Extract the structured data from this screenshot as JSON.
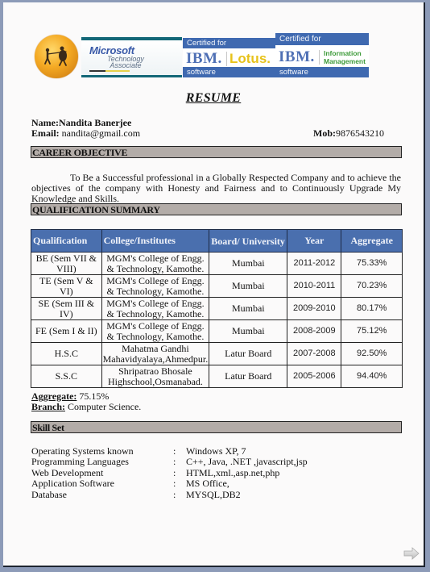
{
  "banner": {
    "logo_icon": "tug-of-war-logo-icon",
    "microsoft": {
      "brand": "Microsoft",
      "line1": "Technology",
      "line2": "Associate"
    },
    "ibm_lotus": {
      "certified_label": "Certified for",
      "ibm": "IBM.",
      "product": "Lotus.",
      "software_label": "software"
    },
    "ibm_info": {
      "certified_label": "Certified for",
      "ibm": "IBM.",
      "product_line1": "Information",
      "product_line2": "Management",
      "software_label": "software"
    }
  },
  "title": "RESUME",
  "contact": {
    "name_label": "Name:",
    "name": "Nandita Banerjee",
    "email_label": "Email:",
    "email": " nandita@gmail.com",
    "mob_label": "Mob:",
    "mob": "9876543210"
  },
  "career_objective": {
    "heading": "CAREER OBJECTIVE",
    "text": "To Be a Successful professional in a Globally Respected Company and to achieve the objectives of the company with Honesty and Fairness and to Continuously Upgrade My Knowledge and Skills."
  },
  "qualification": {
    "heading": "QUALIFICATION SUMMARY",
    "columns": [
      "Qualification",
      "College/Institutes",
      "Board/ University",
      "Year",
      "Aggregate"
    ],
    "rows": [
      {
        "qualification": "BE (Sem VII & VIII)",
        "college": "MGM's College of Engg. & Technology, Kamothe.",
        "board": "Mumbai",
        "year": "2011-2012",
        "aggregate": "75.33%"
      },
      {
        "qualification": "TE (Sem V & VI)",
        "college": "MGM's College of Engg. & Technology, Kamothe.",
        "board": "Mumbai",
        "year": "2010-2011",
        "aggregate": "70.23%"
      },
      {
        "qualification": "SE (Sem III & IV)",
        "college": "MGM's College of Engg. & Technology, Kamothe.",
        "board": "Mumbai",
        "year": "2009-2010",
        "aggregate": "80.17%"
      },
      {
        "qualification": "FE (Sem I & II)",
        "college": "MGM's College of Engg. & Technology, Kamothe.",
        "board": "Mumbai",
        "year": "2008-2009",
        "aggregate": "75.12%"
      },
      {
        "qualification": "H.S.C",
        "college": "Mahatma Gandhi Mahavidyalaya,Ahmedpur.",
        "board": "Latur Board",
        "year": "2007-2008",
        "aggregate": "92.50%"
      },
      {
        "qualification": "S.S.C",
        "college": "Shripatrao Bhosale Highschool,Osmanabad.",
        "board": "Latur Board",
        "year": "2005-2006",
        "aggregate": "94.40%"
      }
    ],
    "aggregate_label": "Aggregate:",
    "aggregate_value": " 75.15%",
    "branch_label": "Branch:",
    "branch_value": " Computer Science."
  },
  "skills": {
    "heading": "Skill Set",
    "items": [
      {
        "label": "Operating Systems known",
        "value": "Windows XP, 7"
      },
      {
        "label": "Programming Languages",
        "value": "C++, Java, .NET ,javascript,jsp"
      },
      {
        "label": "Web Development",
        "value": "HTML,xml.,asp.net,php"
      },
      {
        "label": "Application Software",
        "value": "MS Office,"
      },
      {
        "label": "Database",
        "value": "MYSQL,DB2"
      }
    ],
    "separator": ":"
  },
  "navigation": {
    "next_icon": "next-arrow-icon"
  }
}
